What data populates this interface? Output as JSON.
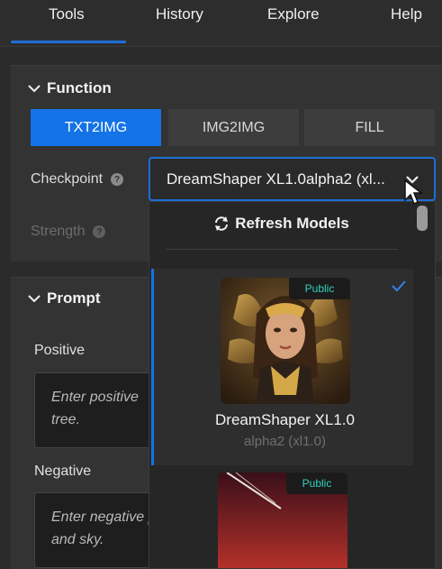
{
  "tabs": [
    {
      "label": "Tools",
      "active": true
    },
    {
      "label": "History",
      "active": false
    },
    {
      "label": "Explore",
      "active": false
    },
    {
      "label": "Help",
      "active": false
    }
  ],
  "colors": {
    "accent": "#1473e6",
    "panel": "#333333",
    "badge_text": "#2fd3c0"
  },
  "function_panel": {
    "title": "Function",
    "modes": [
      "TXT2IMG",
      "IMG2IMG",
      "FILL"
    ],
    "active_mode": "TXT2IMG",
    "checkpoint_label": "Checkpoint",
    "checkpoint_value": "DreamShaper XL1.0alpha2 (xl...",
    "strength_label": "Strength",
    "help_glyph": "?"
  },
  "dropdown": {
    "refresh_label": "Refresh Models",
    "models": [
      {
        "name": "DreamShaper XL1.0",
        "version": "alpha2 (xl1.0)",
        "badge": "Public",
        "selected": true
      },
      {
        "name": "",
        "version": "",
        "badge": "Public",
        "selected": false
      }
    ]
  },
  "prompt_panel": {
    "title": "Prompt",
    "positive_label": "Positive",
    "positive_placeholder": "Enter positive",
    "positive_placeholder_line2": "tree.",
    "negative_label": "Negative",
    "negative_placeholder": "Enter negative prompt descriptions, e.g. river",
    "negative_placeholder_line2": "and sky."
  }
}
